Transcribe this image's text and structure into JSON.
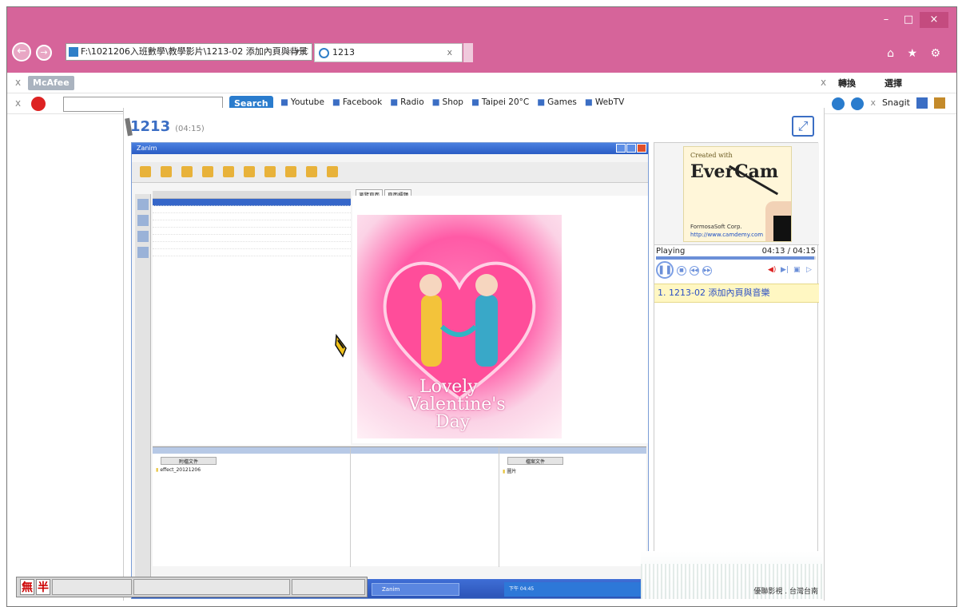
{
  "browser": {
    "address": "F:\\1021206入班數學\\教學影片\\1213-02 添加內頁與背景",
    "address_tools": "⌕ ▾ C",
    "tab_title": "1213",
    "tab_close": "x",
    "window_buttons": [
      "–",
      "□",
      "×"
    ],
    "right_icons": "⌂ ★ ⚙"
  },
  "toolbar1": {
    "close": "x",
    "mcafee": "McAfee",
    "close_right": "x",
    "convert": "轉換",
    "select": "選擇"
  },
  "toolbar2": {
    "close": "x",
    "search_button": "Search",
    "links": [
      "Youtube",
      "Facebook",
      "Radio",
      "Shop",
      "Taipei 20°C",
      "Games",
      "WebTV"
    ],
    "close_right": "x",
    "snagit": "Snagit"
  },
  "page": {
    "title": "1213",
    "duration": "(04:15)",
    "fullscreen_icon": "⤢"
  },
  "recorded_app": {
    "window_title": "Zanim",
    "tab1": "瀏覽頁面",
    "tab2": "頁面標題",
    "attach_label": "附檔文件",
    "attach_label2": "檔案文件",
    "file_item": "effect_20121206",
    "folder_item": "圖片",
    "card_line1": "Lovely",
    "card_line2": "Valentine's",
    "card_line3": "Day",
    "taskbar_app": "Zanim",
    "tray_text": "下午 04:45"
  },
  "ime": {
    "mode1": "無",
    "mode2": "半"
  },
  "player": {
    "thumb_line1": "Created with",
    "thumb_line2": "EverCam",
    "thumb_line3": "FormosaSoft Corp.",
    "thumb_line4": "http://www.camdemy.com",
    "status": "Playing",
    "time": "04:13 / 04:15",
    "progress": 0.99,
    "playlist": [
      "1. 1213-02 添加內頁與音樂"
    ]
  },
  "footer": {
    "text": "優聯影視 . 台灣台南"
  }
}
